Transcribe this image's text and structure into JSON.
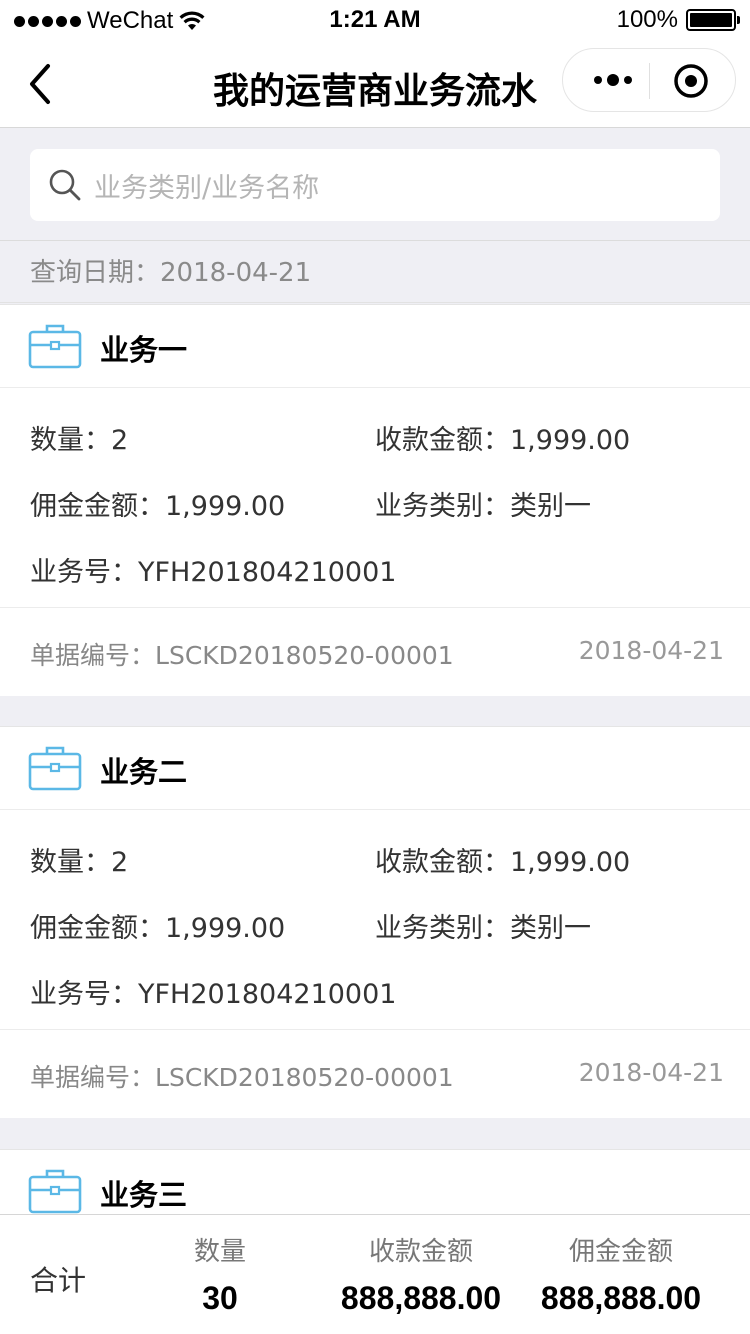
{
  "status_bar": {
    "carrier": "WeChat",
    "time": "1:21 AM",
    "battery": "100%",
    "battery_level": 1.0
  },
  "nav": {
    "title": "我的运营商业务流水"
  },
  "search": {
    "placeholder": "业务类别/业务名称"
  },
  "query": {
    "label": "查询日期：",
    "date": "2018-04-21"
  },
  "labels": {
    "quantity": "数量：",
    "receipt_amount": "收款金额：",
    "commission_amount": "佣金金额：",
    "business_type": "业务类别：",
    "business_no": "业务号：",
    "doc_no": "单据编号："
  },
  "cards": [
    {
      "title": "业务一",
      "quantity": "2",
      "receipt_amount": "1,999.00",
      "commission_amount": "1,999.00",
      "business_type": "类别一",
      "business_no": "YFH201804210001",
      "doc_no": "LSCKD20180520-00001",
      "date": "2018-04-21"
    },
    {
      "title": "业务二",
      "quantity": "2",
      "receipt_amount": "1,999.00",
      "commission_amount": "1,999.00",
      "business_type": "类别一",
      "business_no": "YFH201804210001",
      "doc_no": "LSCKD20180520-00001",
      "date": "2018-04-21"
    },
    {
      "title": "业务三"
    }
  ],
  "totals": {
    "label": "合计",
    "quantity_header": "数量",
    "quantity": "30",
    "receipt_header": "收款金额",
    "receipt": "888,888.00",
    "commission_header": "佣金金额",
    "commission": "888,888.00"
  },
  "colors": {
    "accent_icon": "#5bb8e6",
    "background": "#efeff4"
  }
}
